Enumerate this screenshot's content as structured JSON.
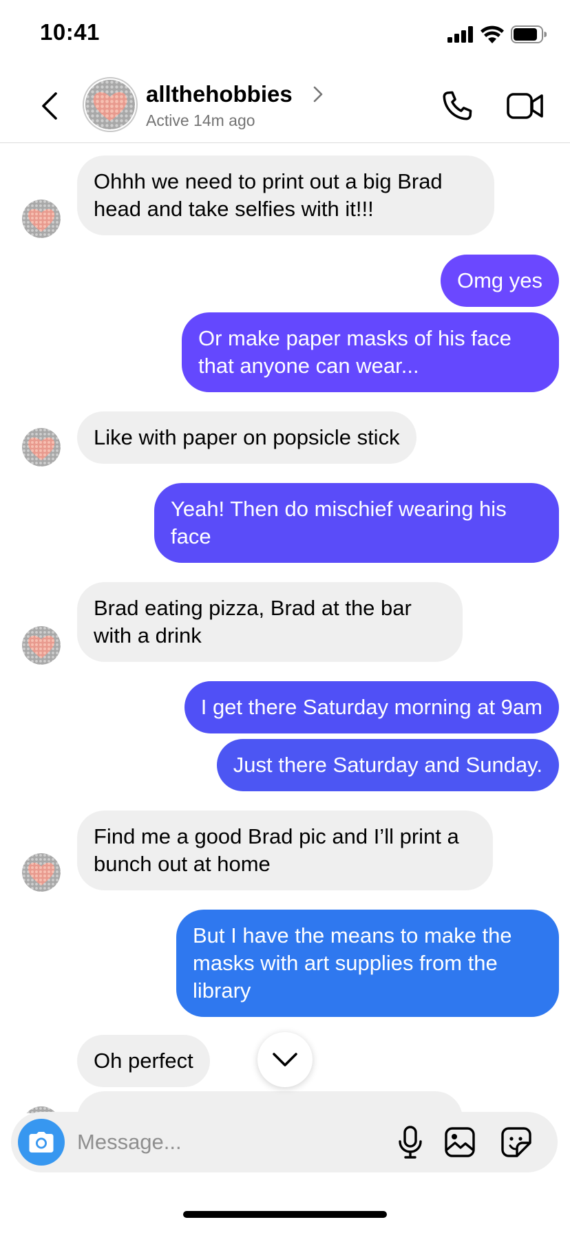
{
  "status_bar": {
    "time": "10:41"
  },
  "header": {
    "username": "allthehobbies",
    "active_status": "Active 14m ago",
    "icons": {
      "back": "chevron-left-icon",
      "profile": "chevron-right-icon",
      "call": "phone-icon",
      "video": "video-camera-icon"
    }
  },
  "colors": {
    "incoming_bubble": "#efefef",
    "outgoing_gradient": [
      "#6b4bff",
      "#4d5cf0",
      "#2f78ef"
    ],
    "camera_button": "#3797f0"
  },
  "messages": [
    {
      "from": "them",
      "text": "Ohhh we need to print out a big Brad head and take selfies with it!!!"
    },
    {
      "from": "me",
      "text": "Omg yes"
    },
    {
      "from": "me",
      "text": "Or make paper masks of his face that anyone can wear..."
    },
    {
      "from": "them",
      "text": "Like with paper on popsicle stick"
    },
    {
      "from": "me",
      "text": "Yeah! Then do mischief wearing his face"
    },
    {
      "from": "them",
      "text": "Brad eating pizza, Brad at the bar with a drink"
    },
    {
      "from": "me",
      "text": "I get there Saturday morning at 9am"
    },
    {
      "from": "me",
      "text": "Just there Saturday and Sunday."
    },
    {
      "from": "them",
      "text": "Find me a good Brad pic and I’ll print a bunch out at home"
    },
    {
      "from": "me",
      "text": "But I have the means to make the masks with art supplies from the library"
    },
    {
      "from": "them",
      "text": "Oh perfect"
    }
  ],
  "composer": {
    "placeholder": "Message...",
    "icons": [
      "camera-icon",
      "microphone-icon",
      "image-icon",
      "sticker-icon"
    ]
  }
}
